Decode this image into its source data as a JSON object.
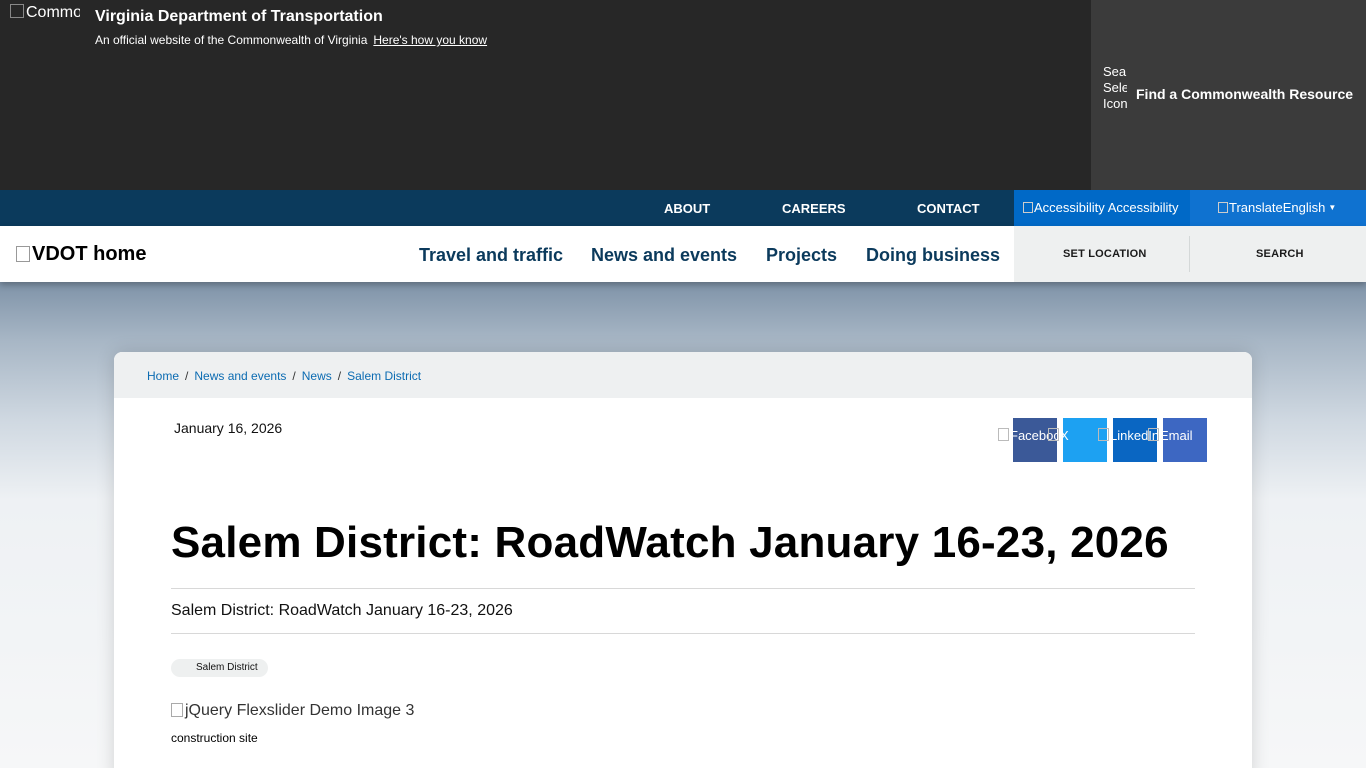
{
  "banner": {
    "logo_alt": "Commonwealth of Virginia",
    "title": "Virginia Department of Transportation",
    "subtitle": "An official website of the Commonwealth of Virginia",
    "how_link": "Here's how you know",
    "resource_icon_alt": "Search Select Icon",
    "resource_label": "Find a Commonwealth Resource"
  },
  "utility_nav": {
    "about": "ABOUT",
    "careers": "CAREERS",
    "contact": "CONTACT",
    "accessibility_alt": "Accessibility",
    "accessibility": "Accessibility",
    "translate_alt": "Translate",
    "language": "English"
  },
  "header": {
    "logo_alt": "VDOT home",
    "nav": [
      "Travel and traffic",
      "News and events",
      "Projects",
      "Doing business"
    ],
    "set_location": "SET LOCATION",
    "search": "SEARCH"
  },
  "breadcrumb": [
    "Home",
    "News and events",
    "News",
    "Salem District"
  ],
  "article": {
    "date": "January 16, 2026",
    "title": "Salem District: RoadWatch January 16-23, 2026",
    "subtitle": "Salem District: RoadWatch January 16-23, 2026",
    "tag": "Salem District",
    "image_alt": "jQuery Flexslider Demo Image 3",
    "caption": "construction site"
  },
  "share": [
    {
      "alt": "Facebook",
      "color": "#3b5998"
    },
    {
      "alt": "X",
      "color": "#1da1f2"
    },
    {
      "alt": "LinkedIn",
      "color": "#0a66c2"
    },
    {
      "alt": "Email",
      "color": "#3d67c2"
    }
  ]
}
